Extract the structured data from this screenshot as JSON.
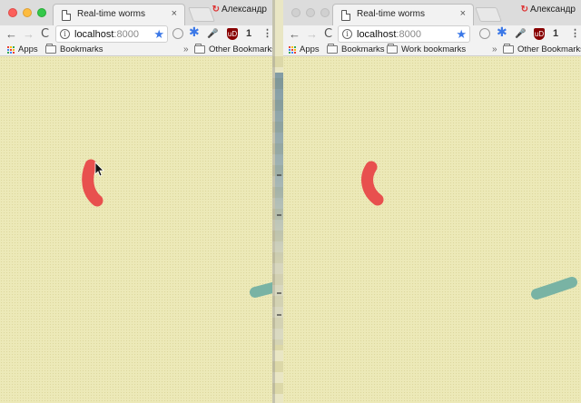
{
  "windows": [
    {
      "id": "left",
      "tab_title": "Real-time worms",
      "tab_close": "×",
      "profile_name": "Александр",
      "url_host": "localhost",
      "url_port": ":8000",
      "extension_count": "1",
      "bookmarks": {
        "apps": "Apps",
        "items": [
          "Bookmarks"
        ],
        "overflow": "»",
        "other": "Other Bookmarks"
      },
      "colors": {
        "red_worm": "#e8504e",
        "teal_worm": "#79b3a4"
      }
    },
    {
      "id": "right",
      "tab_title": "Real-time worms",
      "tab_close": "×",
      "profile_name": "Александр",
      "url_host": "localhost",
      "url_port": ":8000",
      "extension_count": "1",
      "bookmarks": {
        "apps": "Apps",
        "items": [
          "Bookmarks",
          "Work bookmarks"
        ],
        "overflow": "»",
        "other": "Other Bookmarks"
      },
      "colors": {
        "red_worm": "#e8504e",
        "teal_worm": "#79b3a4"
      }
    }
  ],
  "icons": {
    "back": "←",
    "forward": "→",
    "reload": "C",
    "info": "i",
    "star": "★",
    "pin": "✱",
    "mic": "🎤",
    "ublock": "uD",
    "menu": "⋮",
    "profile": "↻"
  }
}
